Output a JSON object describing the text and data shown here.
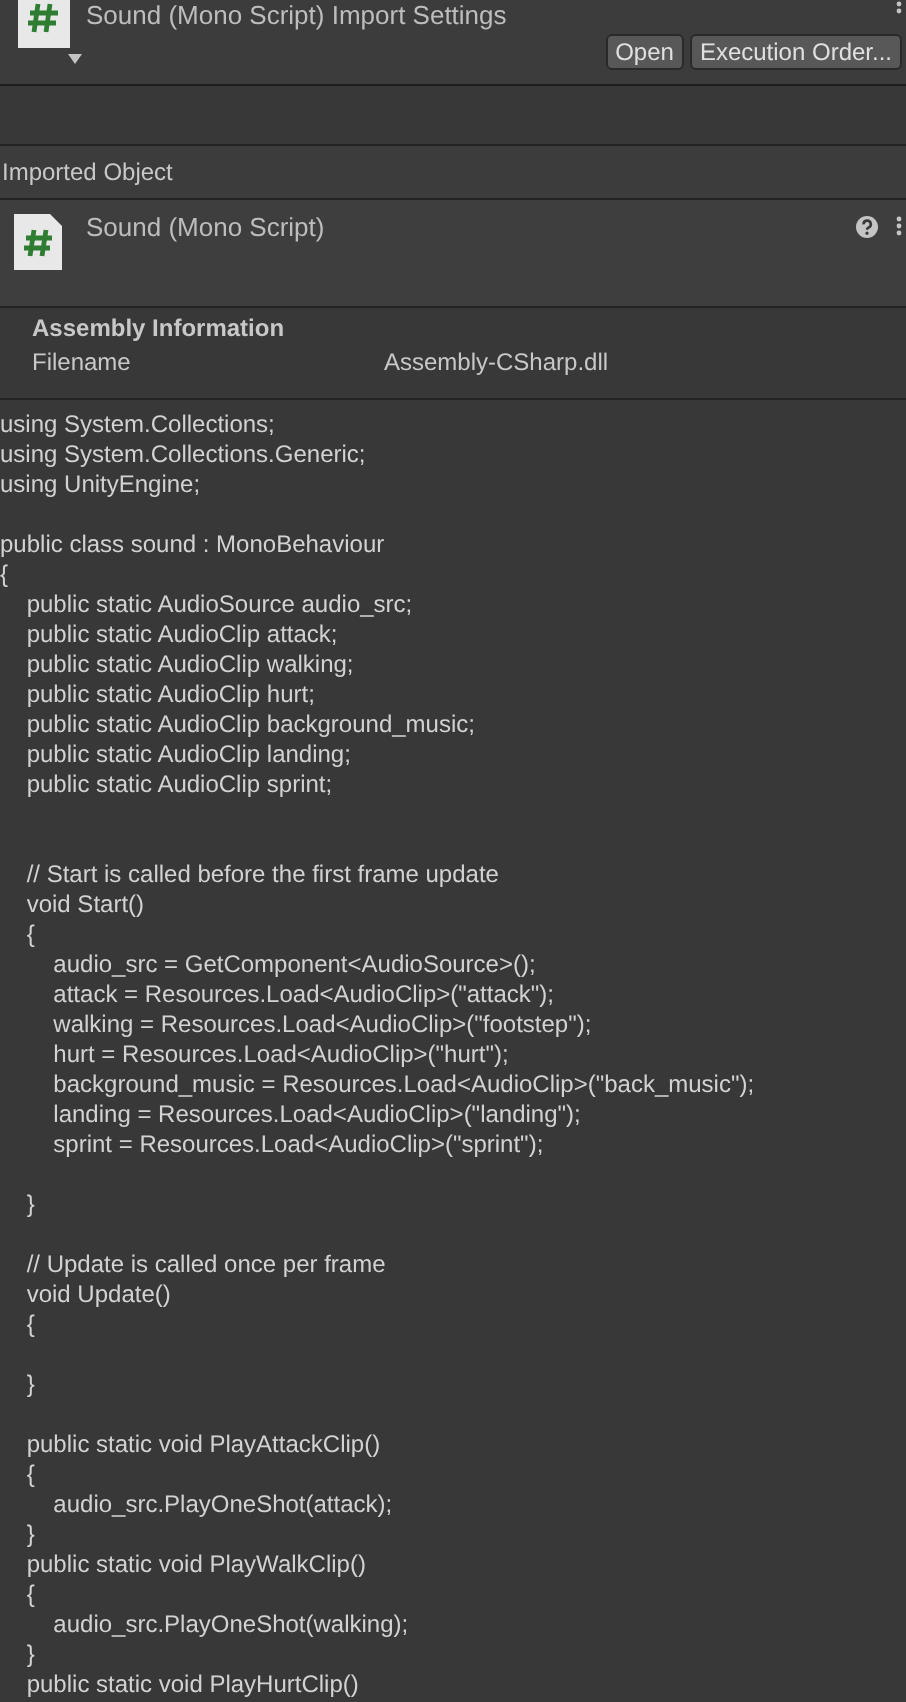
{
  "header": {
    "title": "Sound (Mono Script) Import Settings",
    "buttons": [
      "Open",
      "Execution Order..."
    ]
  },
  "imported_object": {
    "label": "Imported Object",
    "title": "Sound (Mono Script)"
  },
  "assembly": {
    "heading": "Assembly Information",
    "label": "Filename",
    "value": "Assembly-CSharp.dll"
  },
  "code": "using System.Collections;\nusing System.Collections.Generic;\nusing UnityEngine;\n\npublic class sound : MonoBehaviour\n{\n    public static AudioSource audio_src;\n    public static AudioClip attack;\n    public static AudioClip walking;\n    public static AudioClip hurt;\n    public static AudioClip background_music;\n    public static AudioClip landing;\n    public static AudioClip sprint;\n\n\n    // Start is called before the first frame update\n    void Start()\n    {\n        audio_src = GetComponent<AudioSource>();\n        attack = Resources.Load<AudioClip>(\"attack\");\n        walking = Resources.Load<AudioClip>(\"footstep\");\n        hurt = Resources.Load<AudioClip>(\"hurt\");\n        background_music = Resources.Load<AudioClip>(\"back_music\");\n        landing = Resources.Load<AudioClip>(\"landing\");\n        sprint = Resources.Load<AudioClip>(\"sprint\");\n\n    }\n\n    // Update is called once per frame\n    void Update()\n    {\n\n    }\n\n    public static void PlayAttackClip()\n    {\n        audio_src.PlayOneShot(attack);\n    }\n    public static void PlayWalkClip()\n    {\n        audio_src.PlayOneShot(walking);\n    }\n    public static void PlayHurtClip()"
}
